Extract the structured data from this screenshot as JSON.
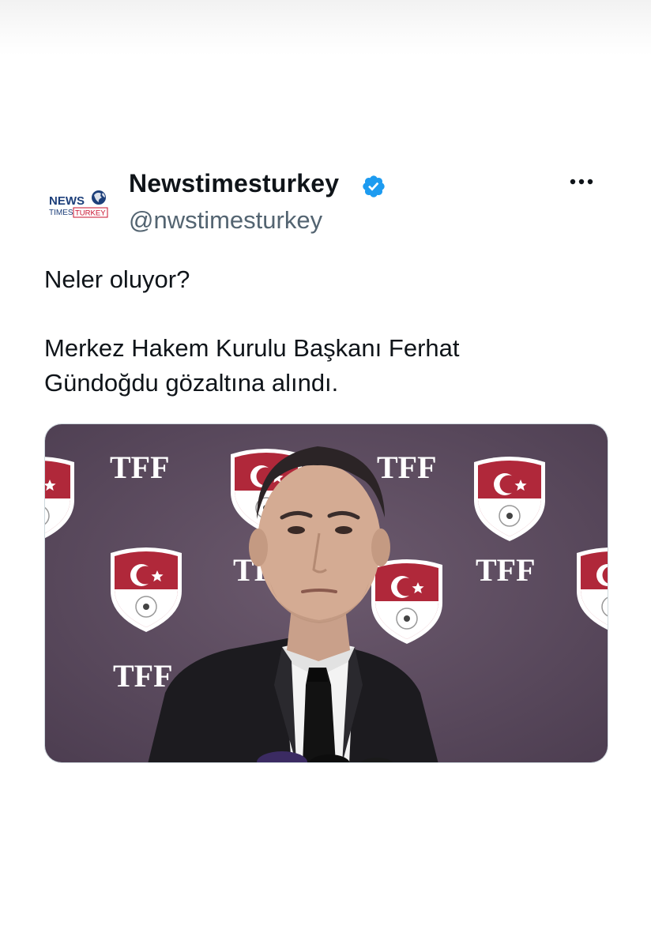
{
  "tweet": {
    "author_name": "Newstimesturkey",
    "author_handle": "@nwstimesturkey",
    "avatar_text": {
      "line1": "NEWS",
      "line2_a": "TIMES",
      "line2_b": "TURKEY"
    },
    "text_lines": [
      "Neler oluyor?",
      "Merkez Hakem Kurulu Başkanı Ferhat",
      "Gündoğdu gözaltına alındı."
    ],
    "media": {
      "backdrop_text": "TFF"
    },
    "icons": {
      "verified": "verified-badge-icon",
      "more": "more-options-icon"
    },
    "colors": {
      "name": "#0f1419",
      "handle": "#536471",
      "verified": "#1d9bf0",
      "backdrop": "#5a4a5c",
      "crest_red": "#b0283a"
    }
  }
}
